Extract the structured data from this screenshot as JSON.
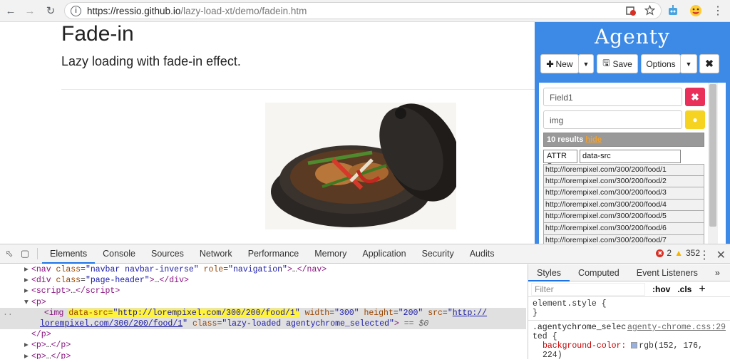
{
  "browser": {
    "url_host": "https://ressio.github.io",
    "url_path": "/lazy-load-xt/demo/fadein.htm",
    "back_icon": "arrow-left-icon",
    "forward_icon": "arrow-right-icon",
    "reload_icon": "reload-icon"
  },
  "page": {
    "title": "Fade-in",
    "lead": "Lazy loading with fade-in effect."
  },
  "agenty": {
    "logo": "Agenty",
    "new_label": "New",
    "save_label": "Save",
    "options_label": "Options",
    "field_name": "Field1",
    "selector": "img",
    "results_text": "10 results",
    "hide_link": "hide",
    "attr_select": "ATTR",
    "attr_value": "data-src",
    "results": [
      "http://lorempixel.com/300/200/food/1",
      "http://lorempixel.com/300/200/food/2",
      "http://lorempixel.com/300/200/food/3",
      "http://lorempixel.com/300/200/food/4",
      "http://lorempixel.com/300/200/food/5",
      "http://lorempixel.com/300/200/food/6",
      "http://lorempixel.com/300/200/food/7"
    ]
  },
  "devtools": {
    "tabs": [
      "Elements",
      "Console",
      "Sources",
      "Network",
      "Performance",
      "Memory",
      "Application",
      "Security",
      "Audits"
    ],
    "errors": "2",
    "warnings": "352",
    "side_tabs": [
      "Styles",
      "Computed",
      "Event Listeners"
    ],
    "filter_placeholder": "Filter",
    "hov": ":hov",
    "cls": ".cls",
    "element_style": "element.style {",
    "close_brace": "}",
    "rule_selector_1": ".agentychrome_selec",
    "rule_selector_2": "ted {",
    "rule_source": "agenty-chrome.css:29",
    "rule_prop": "background-color:",
    "rule_value": "rgb(152, 176, 224)",
    "lines": {
      "nav_tag": "nav",
      "nav_class": "\"navbar navbar-inverse\"",
      "nav_role": "\"navigation\"",
      "div_class": "\"page-header\"",
      "img_datasrc": "\"http://lorempixel.com/300/200/food/1\"",
      "img_width": "\"300\"",
      "img_height": "\"200\"",
      "img_src_1": "http://",
      "img_src_2": "lorempixel.com/300/200/food/1",
      "img_class": "\"lazy-loaded agentychrome_selected\"",
      "eq": "== $0"
    }
  }
}
